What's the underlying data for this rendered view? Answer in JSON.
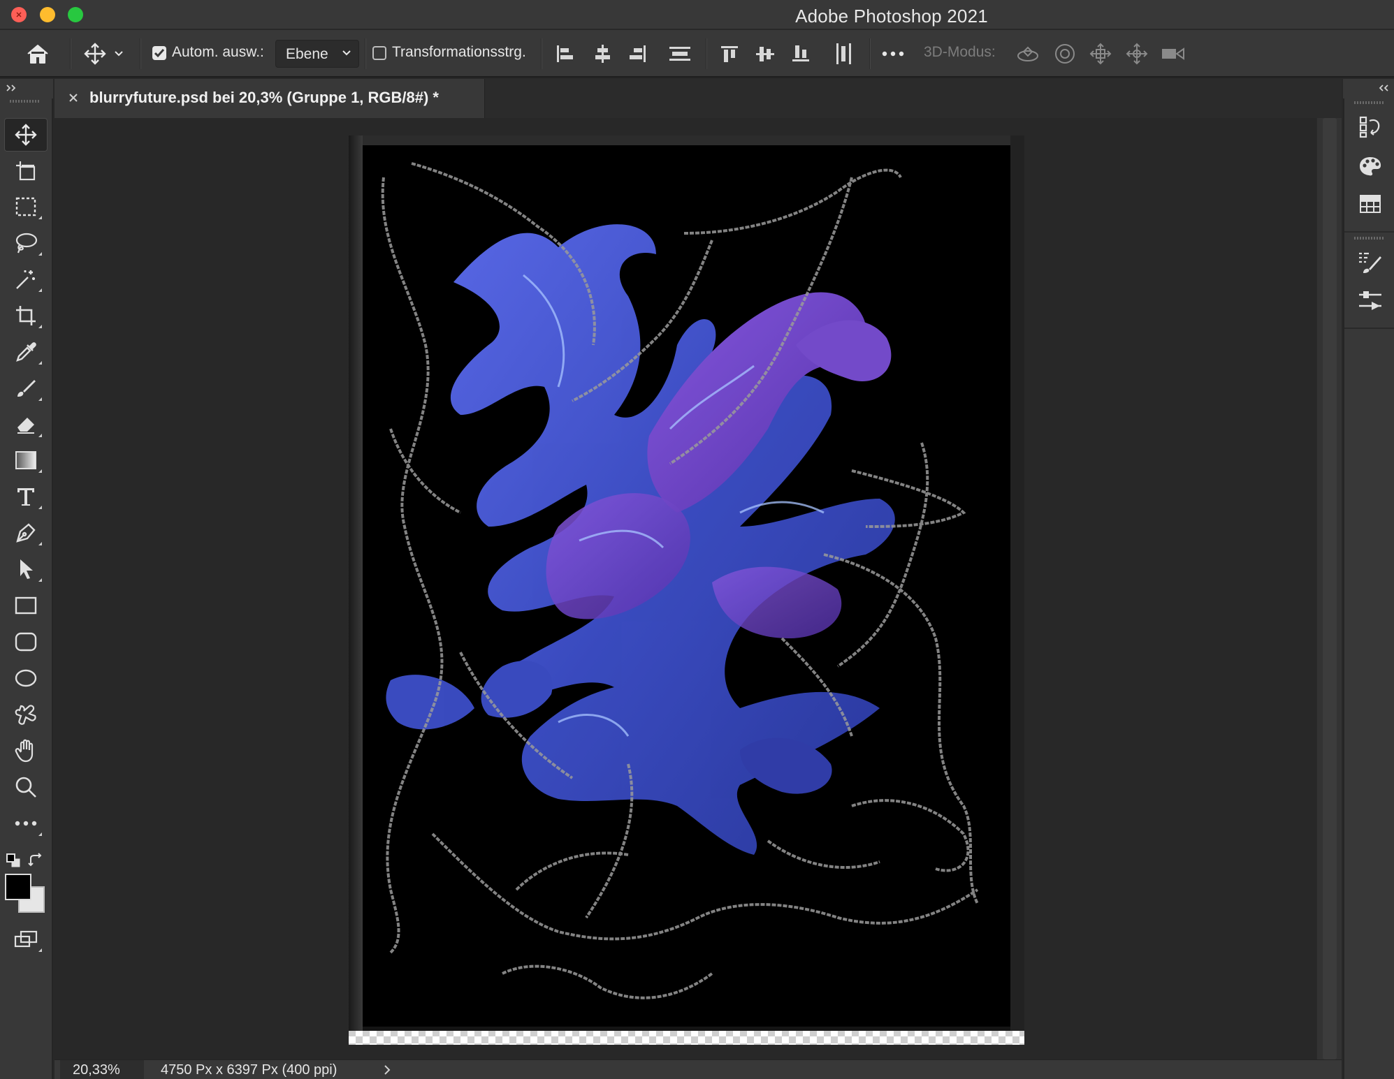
{
  "window": {
    "app_title": "Adobe Photoshop 2021"
  },
  "options_bar": {
    "home_icon": "home-icon",
    "move_tool_icon": "move-icon",
    "auto_select_checked": true,
    "auto_select_label": "Autom. ausw.:",
    "auto_select_target": "Ebene",
    "transform_controls_checked": false,
    "transform_controls_label": "Transformationsstrg.",
    "more_icon": "more-icon",
    "mode_3d_label": "3D-Modus:",
    "align_icons": [
      "align-left-edges-icon",
      "align-horizontal-centers-icon",
      "align-right-edges-icon",
      "distribute-horizontal-icon",
      "align-top-edges-icon",
      "align-vertical-centers-icon",
      "align-bottom-edges-icon",
      "distribute-vertical-icon"
    ],
    "mode_3d_icons": [
      "orbit-3d-icon",
      "roll-3d-icon",
      "pan-3d-icon",
      "slide-3d-icon",
      "zoom-3d-camera-icon"
    ]
  },
  "document": {
    "tab_label": "blurryfuture.psd bei 20,3% (Gruppe 1, RGB/8#) *"
  },
  "toolbar": {
    "tools": [
      {
        "name": "move-tool",
        "icon": "move-icon",
        "active": true
      },
      {
        "name": "artboard-tool",
        "icon": "artboard-icon"
      },
      {
        "name": "rectangular-marquee-tool",
        "icon": "marquee-icon"
      },
      {
        "name": "lasso-tool",
        "icon": "lasso-icon"
      },
      {
        "name": "magic-wand-tool",
        "icon": "magic-wand-icon"
      },
      {
        "name": "crop-tool",
        "icon": "crop-icon"
      },
      {
        "name": "eyedropper-tool",
        "icon": "eyedropper-icon"
      },
      {
        "name": "brush-tool",
        "icon": "brush-icon"
      },
      {
        "name": "eraser-tool",
        "icon": "eraser-icon"
      },
      {
        "name": "gradient-tool",
        "icon": "gradient-icon"
      },
      {
        "name": "type-tool",
        "icon": "type-icon"
      },
      {
        "name": "pen-tool",
        "icon": "pen-icon"
      },
      {
        "name": "path-selection-tool",
        "icon": "arrow-icon"
      },
      {
        "name": "rectangle-tool",
        "icon": "rectangle-icon"
      },
      {
        "name": "rounded-rectangle-tool",
        "icon": "rounded-rectangle-icon"
      },
      {
        "name": "ellipse-tool",
        "icon": "ellipse-icon"
      },
      {
        "name": "custom-shape-tool",
        "icon": "custom-shape-icon"
      },
      {
        "name": "hand-tool",
        "icon": "hand-icon"
      },
      {
        "name": "zoom-tool",
        "icon": "zoom-icon"
      },
      {
        "name": "edit-toolbar",
        "icon": "more-icon"
      }
    ],
    "foreground_color": "#000000",
    "background_color": "#e6e6e6"
  },
  "status_bar": {
    "zoom": "20,33%",
    "doc_info": "4750 Px x 6397 Px (400 ppi)"
  },
  "right_panel": {
    "buttons": [
      "history-icon",
      "color-palette-icon",
      "swatches-grid-icon",
      "brush-settings-icon",
      "adjustments-icon"
    ]
  },
  "colors": {
    "ui_panel": "#383838",
    "workspace": "#282828",
    "art_blue": "#4a5bdc",
    "art_violet": "#7b4fe0",
    "art_background": "#000000"
  }
}
